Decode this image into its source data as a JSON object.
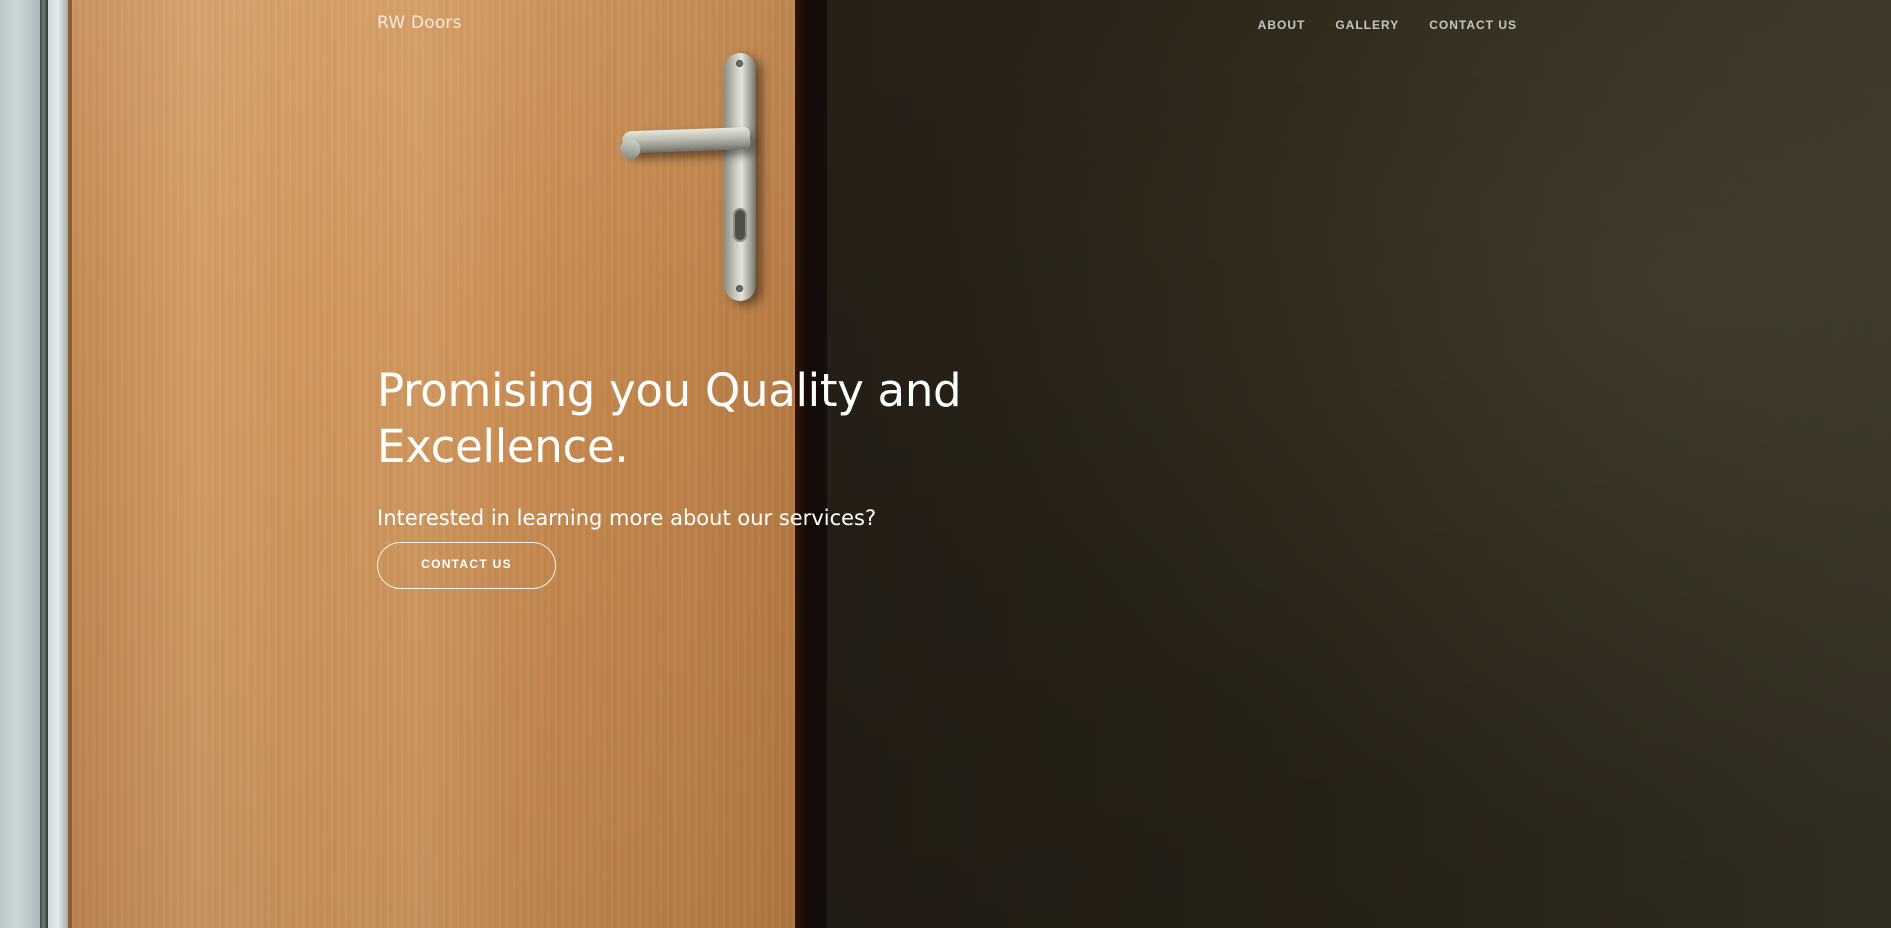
{
  "brand": {
    "name": "RW Doors"
  },
  "nav": {
    "items": [
      {
        "label": "ABOUT"
      },
      {
        "label": "GALLERY"
      },
      {
        "label": "CONTACT US"
      }
    ]
  },
  "hero": {
    "title": "Promising you Quality and Excellence.",
    "subtitle": "Interested in learning more about our services?",
    "cta_label": "CONTACT US",
    "background_image": "wooden-door-with-handle-photo"
  },
  "colors": {
    "text": "#ffffff",
    "nav_text": "#d9d4cc",
    "wood": "#cf9458",
    "dark_wall": "#241d16",
    "cta_border": "#ffffff"
  }
}
